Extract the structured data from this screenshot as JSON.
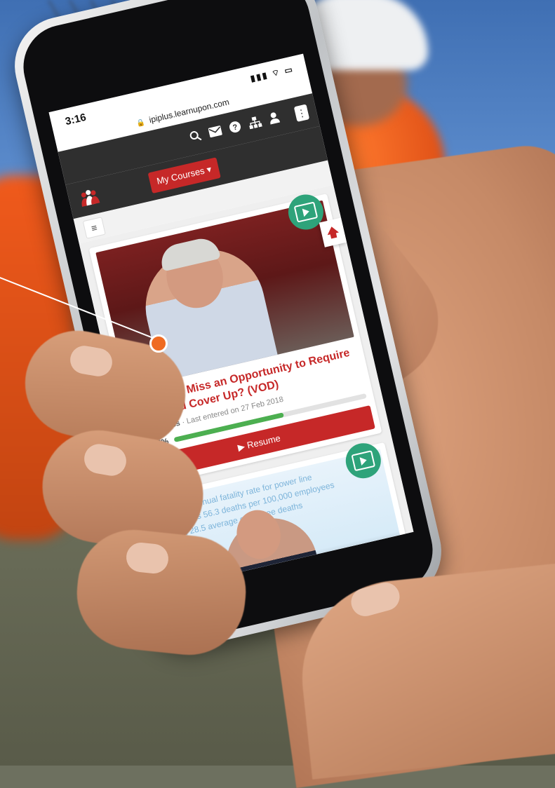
{
  "status": {
    "time": "3:16",
    "signal": "▮▮▮ ⌔ ▭"
  },
  "browser": {
    "url": "ipiplus.learnupon.com"
  },
  "nav": {
    "my_courses_label": "My Courses ▾",
    "more_label": "⋮",
    "menu_label": "≡"
  },
  "courses": [
    {
      "title": "Did OSHA Miss an Opportunity to Require Increased Cover Up? (VOD)",
      "status": "In Progress",
      "last_entered": "Last entered on 27 Feb 2018",
      "progress_label": "57%",
      "progress_fraction": 0.57,
      "resume_label": "▶  Resume"
    },
    {
      "slide_lines": [
        "average annual fatality rate for power line",
        "workers is 56.3 deaths per 100,000 employees",
        "2010, 28.5 average employee deaths"
      ]
    }
  ],
  "colors": {
    "accent": "#c62828",
    "progress": "#4caf50",
    "badge": "#2ea37a",
    "annotation": "#ef6b22"
  },
  "icons": [
    "search-icon",
    "mail-icon",
    "help-icon",
    "org-chart-icon",
    "user-icon",
    "video-icon",
    "arrow-up-icon",
    "lock-icon"
  ]
}
